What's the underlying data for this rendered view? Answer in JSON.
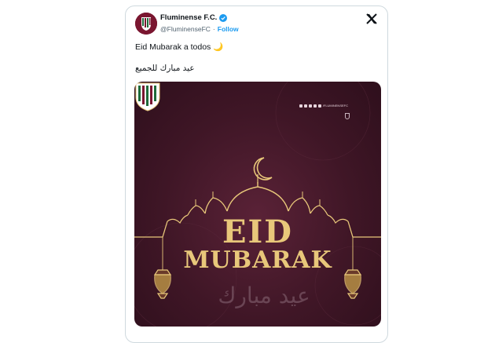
{
  "tweet": {
    "display_name": "Fluminense F.C.",
    "handle": "@FluminenseFC",
    "separator": "·",
    "follow_label": "Follow",
    "text_line_1": "Eid Mubarak a todos 🌙",
    "text_line_2": "عيد مبارك للجميع"
  },
  "media": {
    "headline_1": "EID",
    "headline_2": "MUBARAK",
    "calligraphy": "عيد مبارك",
    "social_handle": "/FLUMINENSEFC",
    "colors": {
      "background": "#3f1626",
      "gold": "#e8c77a",
      "club_maroon": "#7a1630",
      "club_green": "#1e6b3a"
    }
  },
  "icons": {
    "verified": "verified-badge-icon",
    "x_logo": "x-logo-icon"
  },
  "colors": {
    "link": "#1d9bf0",
    "border": "#cfd9de",
    "text": "#0f1419",
    "muted": "#536471"
  }
}
